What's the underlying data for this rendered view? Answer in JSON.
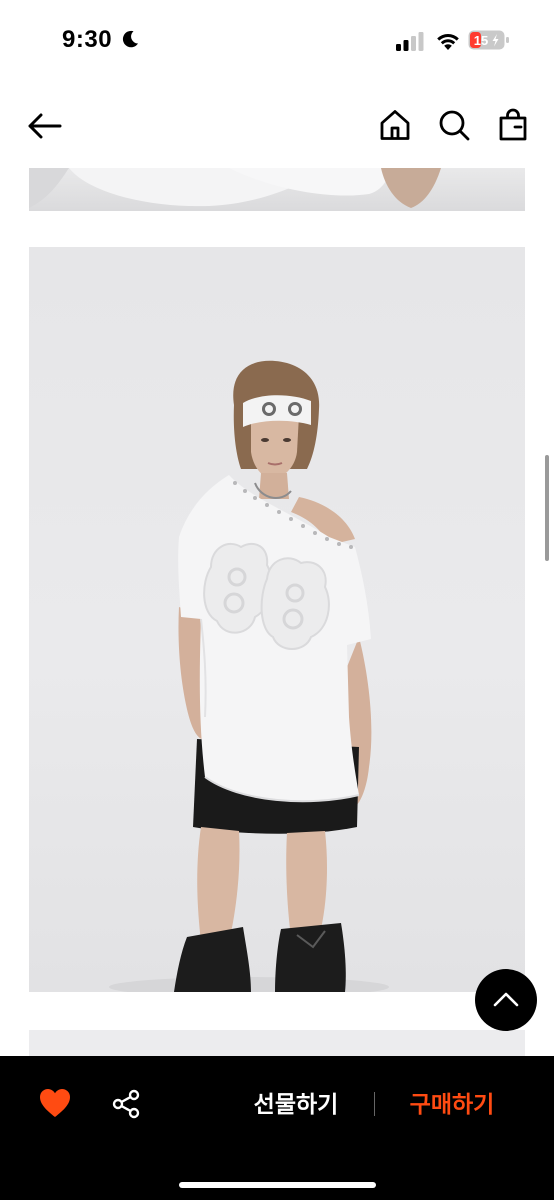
{
  "status_bar": {
    "time": "9:30",
    "battery_level": "15"
  },
  "nav": {
    "back": "back-arrow-icon",
    "home": "home-icon",
    "search": "search-icon",
    "bag": "shopping-bag-icon"
  },
  "product_images": [
    {
      "name": "product-photo-top-partial"
    },
    {
      "name": "product-photo-model-white-tee"
    },
    {
      "name": "product-photo-next-partial"
    }
  ],
  "actions": {
    "like_icon": "heart-icon",
    "share_icon": "share-icon",
    "gift_label": "선물하기",
    "buy_label": "구매하기",
    "scroll_top_icon": "chevron-up-icon"
  },
  "colors": {
    "accent_buy": "#ff4b12",
    "heart": "#ff4b12",
    "bottom_bar": "#000000"
  }
}
